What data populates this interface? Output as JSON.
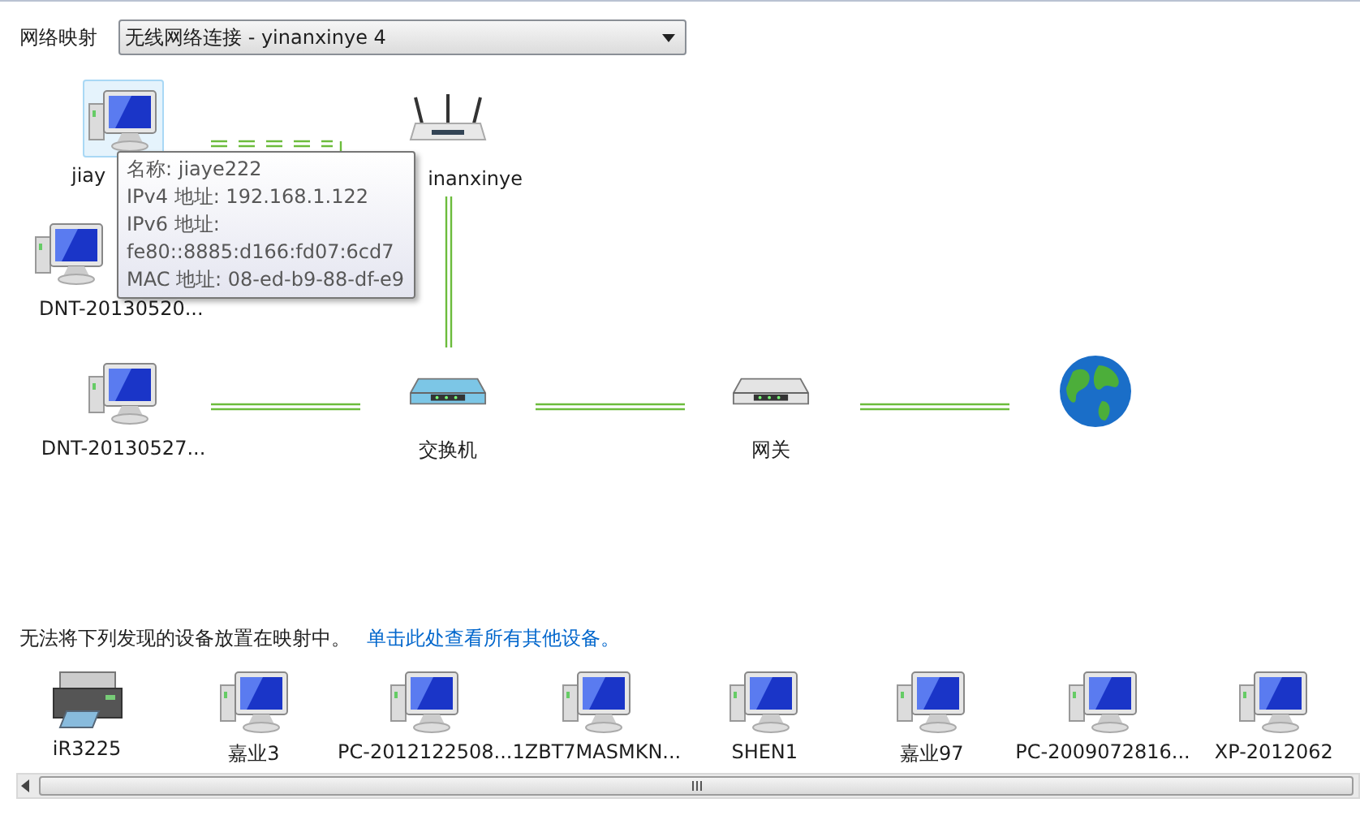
{
  "header": {
    "label": "网络映射",
    "dropdown": {
      "value": "无线网络连接 - yinanxinye  4"
    }
  },
  "map": {
    "nodes": [
      {
        "kind": "computer",
        "label": "jiay",
        "selected": true
      },
      {
        "kind": "router",
        "label": "inanxinye",
        "selected": false
      },
      {
        "kind": "computer",
        "label": "DNT-20130520...",
        "selected": false
      },
      {
        "kind": "computer",
        "label": "DNT-20130527...",
        "selected": false
      },
      {
        "kind": "switch",
        "label": "交换机",
        "selected": false
      },
      {
        "kind": "gateway",
        "label": "网关",
        "selected": false
      },
      {
        "kind": "internet",
        "selected": false
      }
    ],
    "tooltip": [
      "名称: jiaye222",
      "IPv4 地址: 192.168.1.122",
      "IPv6 地址:",
      "fe80::8885:d166:fd07:6cd7",
      "MAC 地址: 08-ed-b9-88-df-e9"
    ]
  },
  "other_devices": {
    "message": "无法将下列发现的设备放置在映射中。",
    "link": "单击此处查看所有其他设备。",
    "devices": [
      {
        "kind": "printer",
        "label": "iR3225"
      },
      {
        "kind": "computer",
        "label": "嘉业3"
      },
      {
        "kind": "computer",
        "label": "PC-2012122508..."
      },
      {
        "kind": "computer",
        "label": "1ZBT7MASMKN..."
      },
      {
        "kind": "computer",
        "label": "SHEN1"
      },
      {
        "kind": "computer",
        "label": "嘉业97"
      },
      {
        "kind": "computer",
        "label": "PC-2009072816..."
      },
      {
        "kind": "computer",
        "label": "XP-2012062"
      }
    ]
  }
}
